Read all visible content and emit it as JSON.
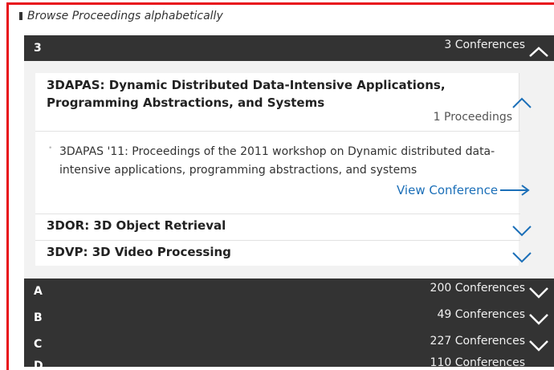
{
  "browse": {
    "title": "Browse Proceedings alphabetically"
  },
  "letters": [
    {
      "letter": "3",
      "count": "3 Conferences"
    },
    {
      "letter": "A",
      "count": "200 Conferences"
    },
    {
      "letter": "B",
      "count": "49 Conferences"
    },
    {
      "letter": "C",
      "count": "227 Conferences"
    },
    {
      "letter": "D",
      "count": "110 Conferences"
    }
  ],
  "conferences": [
    {
      "title": "3DAPAS: Dynamic Distributed Data-Intensive Applications, Programming Abstractions, and Systems",
      "count": "1 Proceedings",
      "proceeding": "3DAPAS '11: Proceedings of the 2011 workshop on Dynamic distributed data-intensive applications, programming abstractions, and systems",
      "view_label": "View Conference"
    },
    {
      "title": "3DOR: 3D Object Retrieval"
    },
    {
      "title": "3DVP: 3D Video Processing"
    }
  ],
  "colors": {
    "frame": "#e8101a",
    "bar": "#333333",
    "link": "#1b6fb8"
  },
  "icons": {
    "expanded": "chevron-up-icon",
    "collapsed": "chevron-down-icon",
    "arrow": "arrow-right-icon"
  }
}
